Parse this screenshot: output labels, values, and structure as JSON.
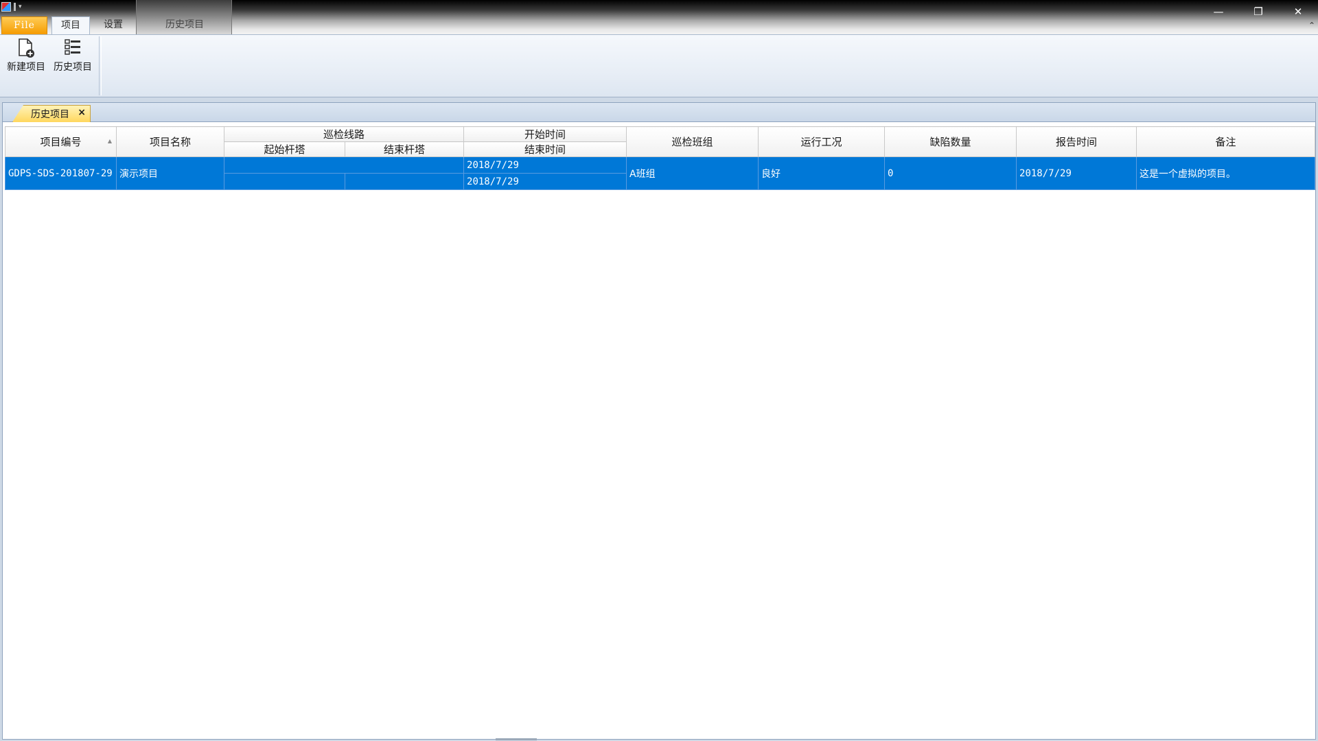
{
  "window": {
    "minimize_glyph": "—",
    "restore_glyph": "❐",
    "close_glyph": "✕",
    "collapse_glyph": "⌃"
  },
  "ribbon": {
    "tabs": {
      "file": "File",
      "project": "项目",
      "settings": "设置",
      "history": "历史项目"
    },
    "buttons": {
      "new_project": "新建项目",
      "history_projects": "历史项目"
    }
  },
  "document": {
    "tab_label": "历史项目",
    "tab_close": "×"
  },
  "grid": {
    "headers": {
      "project_no": "项目编号",
      "project_name": "项目名称",
      "route": "巡检线路",
      "start_tower": "起始杆塔",
      "end_tower": "结束杆塔",
      "start_time": "开始时间",
      "end_time": "结束时间",
      "team": "巡检班组",
      "condition": "运行工况",
      "defects": "缺陷数量",
      "report_time": "报告时间",
      "remarks": "备注"
    },
    "rows": [
      {
        "project_no": "GDPS-SDS-201807-29",
        "project_name": "演示项目",
        "start_tower": "",
        "end_tower": "",
        "start_time": "2018/7/29",
        "end_time": "2018/7/29",
        "team": "A班组",
        "condition": "良好",
        "defects": "0",
        "report_time": "2018/7/29",
        "remarks": "这是一个虚拟的项目。"
      }
    ]
  },
  "colors": {
    "selection": "#0078d7",
    "file_tab": "#f59b00",
    "doc_tab": "#ffd75e"
  }
}
